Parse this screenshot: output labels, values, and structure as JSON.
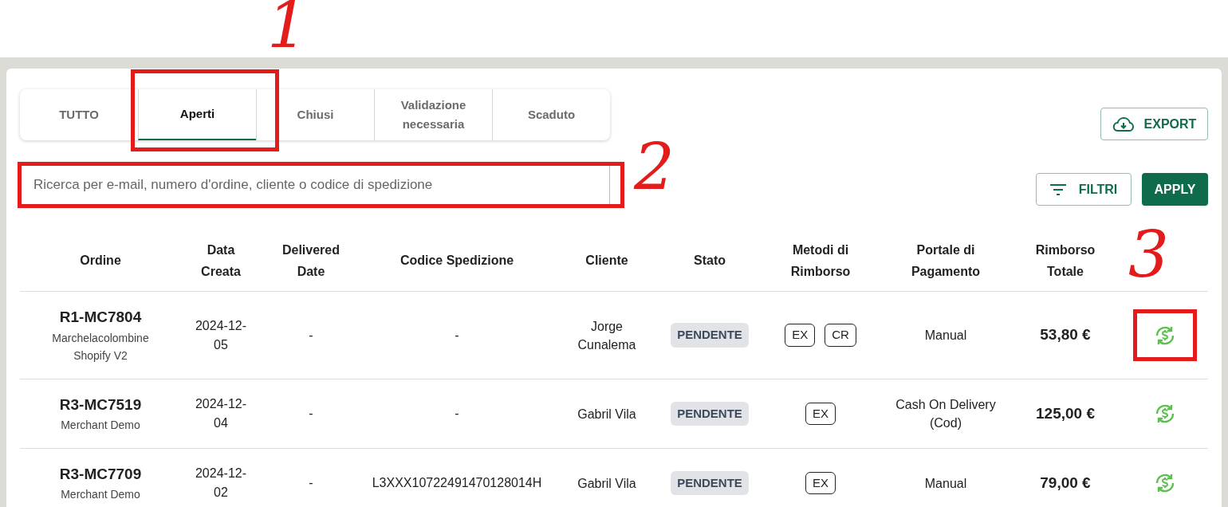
{
  "tabs": [
    {
      "label": "TUTTO",
      "selected": false,
      "highlighted": false
    },
    {
      "label": "Aperti",
      "selected": true,
      "highlighted": true
    },
    {
      "label": "Chiusi",
      "selected": false,
      "highlighted": false
    },
    {
      "label": "Validazione necessaria",
      "selected": false,
      "highlighted": false
    },
    {
      "label": "Scaduto",
      "selected": false,
      "highlighted": false
    }
  ],
  "export_button": "EXPORT",
  "search": {
    "placeholder": "Ricerca per e-mail, numero d'ordine, cliente o codice di spedizione",
    "highlighted": true
  },
  "filter_button": "FILTRI",
  "apply_button": "APPLY",
  "table": {
    "columns": [
      "Ordine",
      "Data Creata",
      "Delivered Date",
      "Codice Spedizione",
      "Cliente",
      "Stato",
      "Metodi di Rimborso",
      "Portale di Pagamento",
      "Rimborso Totale"
    ],
    "rows": [
      {
        "order": "R1-MC7804",
        "merchant": "Marchelacolombine Shopify V2",
        "created": "2024-12-05",
        "delivered": "-",
        "tracking": "-",
        "customer": "Jorge Cunalema",
        "status": "PENDENTE",
        "methods": [
          "EX",
          "CR"
        ],
        "gateway": "Manual",
        "total": "53,80 €",
        "action_highlighted": true
      },
      {
        "order": "R3-MC7519",
        "merchant": "Merchant Demo",
        "created": "2024-12-04",
        "delivered": "-",
        "tracking": "-",
        "customer": "Gabril Vila",
        "status": "PENDENTE",
        "methods": [
          "EX"
        ],
        "gateway": "Cash On Delivery (Cod)",
        "total": "125,00 €",
        "action_highlighted": false
      },
      {
        "order": "R3-MC7709",
        "merchant": "Merchant Demo",
        "created": "2024-12-02",
        "delivered": "-",
        "tracking": "L3XXX10722491470128014H",
        "customer": "Gabril Vila",
        "status": "PENDENTE",
        "methods": [
          "EX"
        ],
        "gateway": "Manual",
        "total": "79,00 €",
        "action_highlighted": false
      }
    ]
  },
  "annotations": [
    {
      "label": "1"
    },
    {
      "label": "2"
    },
    {
      "label": "3"
    }
  ]
}
